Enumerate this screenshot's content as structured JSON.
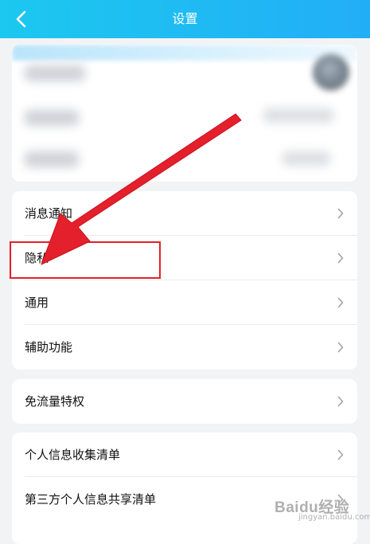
{
  "header": {
    "title": "设置",
    "back_icon": "back-chevron-icon"
  },
  "colors": {
    "header_start": "#1cc8ef",
    "header_end": "#22aef7",
    "annotation_red": "#e3202c",
    "page_background": "#f2f3f5"
  },
  "groups": [
    {
      "items": [
        {
          "label": "消息通知",
          "icon": "chevron-right-icon"
        },
        {
          "label": "隐私",
          "icon": "chevron-right-icon"
        },
        {
          "label": "通用",
          "icon": "chevron-right-icon"
        },
        {
          "label": "辅助功能",
          "icon": "chevron-right-icon"
        }
      ]
    },
    {
      "items": [
        {
          "label": "免流量特权",
          "icon": "chevron-right-icon"
        }
      ]
    },
    {
      "items": [
        {
          "label": "个人信息收集清单",
          "icon": "chevron-right-icon"
        },
        {
          "label": "第三方个人信息共享清单",
          "icon": "chevron-right-icon"
        }
      ]
    }
  ],
  "annotation": {
    "highlighted_item": "隐私",
    "arrow_icon": "red-arrow-icon"
  },
  "watermark": {
    "text": "Baidu经验",
    "sub": "jingyan.baidu.com"
  }
}
